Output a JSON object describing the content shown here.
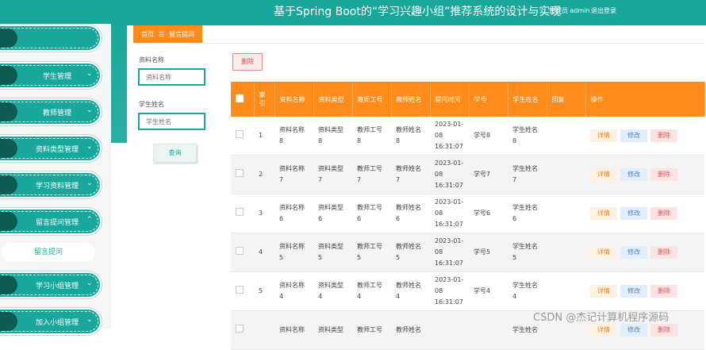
{
  "header": {
    "title": "基于Spring Boot的“学习兴趣小组”推荐系统的设计与实现",
    "admin": "管理员 admin",
    "logout": "退出登录"
  },
  "sidebar": {
    "items": [
      {
        "label": ""
      },
      {
        "label": "学生管理"
      },
      {
        "label": "教师管理"
      },
      {
        "label": "资料类型管理"
      },
      {
        "label": "学习资料管理"
      },
      {
        "label": "留言提问管理"
      },
      {
        "label": "学习小组管理"
      },
      {
        "label": "加入小组管理"
      }
    ],
    "subitem": "留言提问"
  },
  "breadcrumb": {
    "home": "首页",
    "sep": "☰",
    "current": "留言提问"
  },
  "search": {
    "label1": "资料名称",
    "placeholder1": "资料名称",
    "label2": "学生姓名",
    "placeholder2": "学生姓名",
    "button": "查询"
  },
  "toolbar": {
    "delete": "删除"
  },
  "table": {
    "headers": [
      "索引",
      "资料名称",
      "资料类型",
      "教师工号",
      "教师姓名",
      "提问时间",
      "学号",
      "学生姓名",
      "回复",
      "操作"
    ],
    "rows": [
      {
        "idx": "1",
        "name": "资料名称8",
        "type": "资料类型8",
        "tid": "教师工号8",
        "tname": "教师姓名8",
        "time": "2023-01-08 16:31:07",
        "sid": "学号8",
        "sname": "学生姓名8",
        "reply": ""
      },
      {
        "idx": "2",
        "name": "资料名称7",
        "type": "资料类型7",
        "tid": "教师工号7",
        "tname": "教师姓名7",
        "time": "2023-01-08 16:31:07",
        "sid": "学号7",
        "sname": "学生姓名7",
        "reply": ""
      },
      {
        "idx": "3",
        "name": "资料名称6",
        "type": "资料类型6",
        "tid": "教师工号6",
        "tname": "教师姓名6",
        "time": "2023-01-08 16:31:07",
        "sid": "学号6",
        "sname": "学生姓名6",
        "reply": ""
      },
      {
        "idx": "4",
        "name": "资料名称5",
        "type": "资料类型5",
        "tid": "教师工号5",
        "tname": "教师姓名5",
        "time": "2023-01-08 16:31:07",
        "sid": "学号5",
        "sname": "学生姓名5",
        "reply": ""
      },
      {
        "idx": "5",
        "name": "资料名称4",
        "type": "资料类型4",
        "tid": "教师工号4",
        "tname": "教师姓名4",
        "time": "2023-01-08 16:31:07",
        "sid": "学号4",
        "sname": "学生姓名4",
        "reply": ""
      },
      {
        "idx": "",
        "name": "资料名称",
        "type": "资料类型",
        "tid": "教师工号",
        "tname": "教师姓名",
        "time": "",
        "sid": "",
        "sname": "学生姓名",
        "reply": ""
      }
    ],
    "actions": {
      "detail": "详情",
      "edit": "修改",
      "delete": "删除"
    }
  },
  "watermark": "CSDN @杰记计算机程序源码",
  "colors": {
    "teal": "#1aa79b",
    "orange": "#ff8c1a"
  }
}
